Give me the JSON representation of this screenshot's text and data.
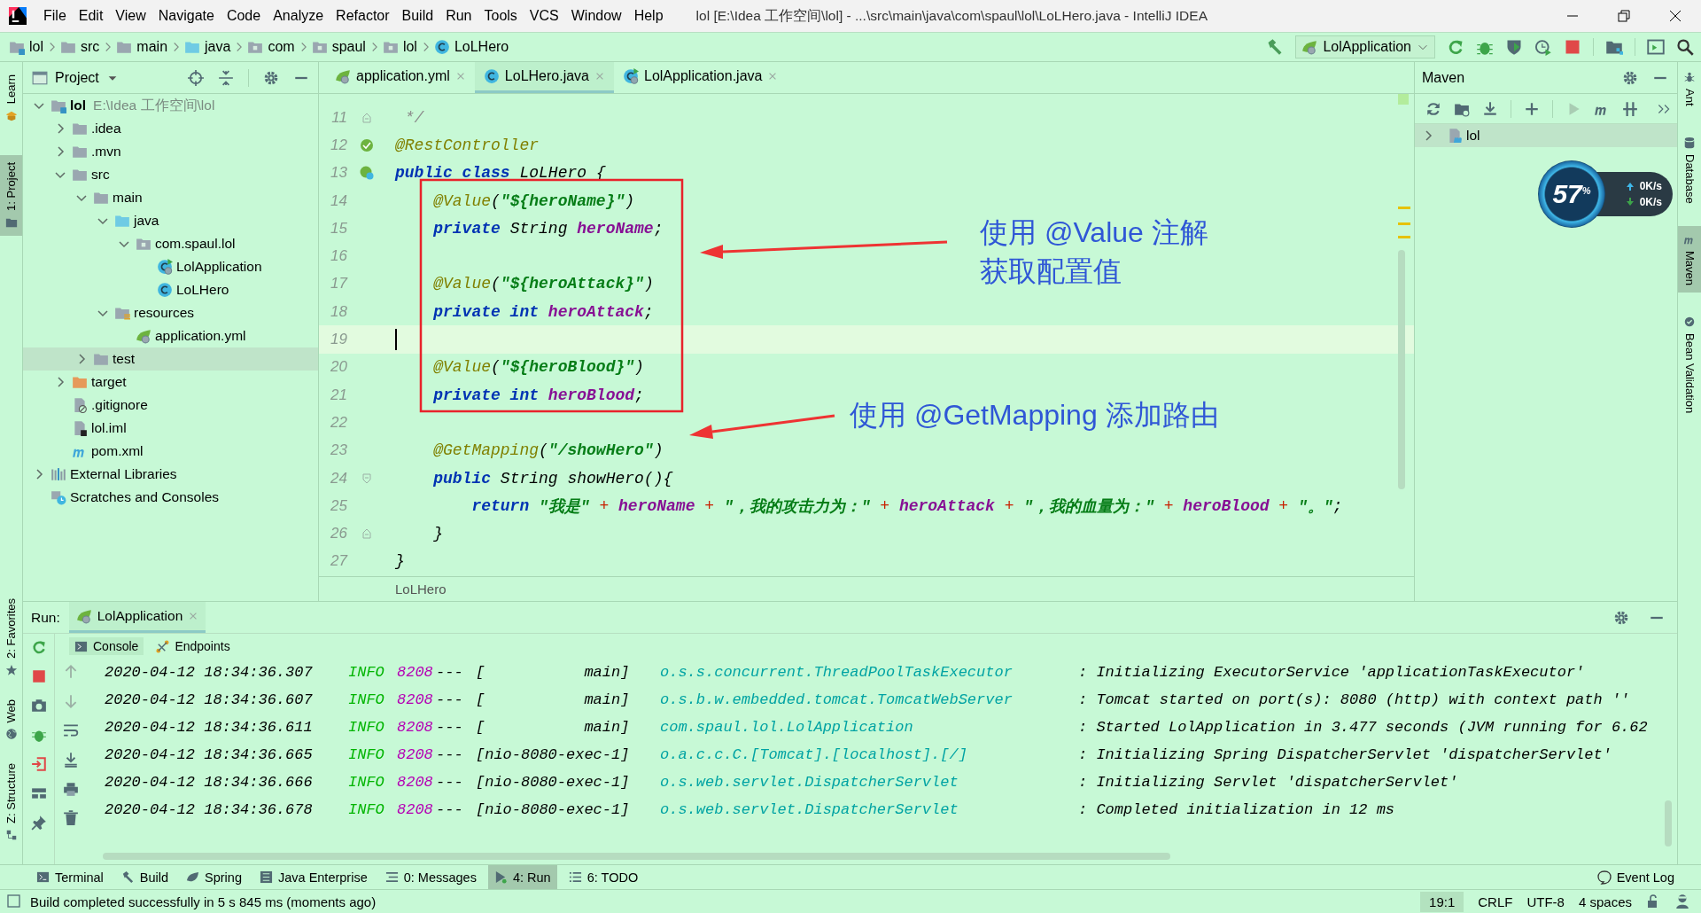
{
  "window": {
    "title": "lol [E:\\Idea 工作空间\\lol] - ...\\src\\main\\java\\com\\spaul\\lol\\LoLHero.java - IntelliJ IDEA"
  },
  "menu": [
    "File",
    "Edit",
    "View",
    "Navigate",
    "Code",
    "Analyze",
    "Refactor",
    "Build",
    "Run",
    "Tools",
    "VCS",
    "Window",
    "Help"
  ],
  "breadcrumbs": [
    {
      "label": "lol",
      "kind": "module"
    },
    {
      "label": "src",
      "kind": "folder"
    },
    {
      "label": "main",
      "kind": "folder"
    },
    {
      "label": "java",
      "kind": "source"
    },
    {
      "label": "com",
      "kind": "package"
    },
    {
      "label": "spaul",
      "kind": "package"
    },
    {
      "label": "lol",
      "kind": "package"
    },
    {
      "label": "LoLHero",
      "kind": "class"
    }
  ],
  "run_config": "LolApplication",
  "left_stripe": [
    {
      "label": "Learn",
      "kind": "learn",
      "selected": false
    },
    {
      "label": "1: Project",
      "kind": "project",
      "selected": true
    }
  ],
  "left_stripe_bottom": [
    {
      "label": "2: Favorites",
      "kind": "star",
      "selected": false
    },
    {
      "label": "Web",
      "kind": "globe",
      "selected": false
    },
    {
      "label": "Z: Structure",
      "kind": "structure",
      "selected": false
    }
  ],
  "right_stripe": [
    {
      "label": "Ant",
      "kind": "ant",
      "selected": false
    },
    {
      "label": "Database",
      "kind": "database",
      "selected": false
    },
    {
      "label": "Maven",
      "kind": "maven",
      "selected": true
    },
    {
      "label": "Bean Validation",
      "kind": "bean",
      "selected": false
    }
  ],
  "project": {
    "title": "Project",
    "tree": [
      {
        "label": "lol",
        "path": "E:\\Idea 工作空间\\lol",
        "kind": "module",
        "expanded": true,
        "selected": false,
        "children": [
          {
            "label": ".idea",
            "kind": "folder",
            "expanded": false,
            "selected": false
          },
          {
            "label": ".mvn",
            "kind": "folder",
            "expanded": false,
            "selected": false
          },
          {
            "label": "src",
            "kind": "folder",
            "expanded": true,
            "selected": false,
            "children": [
              {
                "label": "main",
                "kind": "folder",
                "expanded": true,
                "selected": false,
                "children": [
                  {
                    "label": "java",
                    "kind": "source",
                    "expanded": true,
                    "selected": false,
                    "children": [
                      {
                        "label": "com.spaul.lol",
                        "kind": "package",
                        "expanded": true,
                        "selected": false,
                        "children": [
                          {
                            "label": "LolApplication",
                            "kind": "app",
                            "selected": false
                          },
                          {
                            "label": "LoLHero",
                            "kind": "class",
                            "selected": false
                          }
                        ]
                      }
                    ]
                  },
                  {
                    "label": "resources",
                    "kind": "resources",
                    "expanded": true,
                    "selected": false,
                    "children": [
                      {
                        "label": "application.yml",
                        "kind": "yml",
                        "selected": false
                      }
                    ]
                  }
                ]
              },
              {
                "label": "test",
                "kind": "folder",
                "expanded": false,
                "selected": true
              }
            ]
          },
          {
            "label": "target",
            "kind": "target",
            "expanded": false,
            "selected": false
          },
          {
            "label": ".gitignore",
            "kind": "gitignore",
            "selected": false
          },
          {
            "label": "lol.iml",
            "kind": "iml",
            "selected": false
          },
          {
            "label": "pom.xml",
            "kind": "maven",
            "selected": false
          }
        ]
      },
      {
        "label": "External Libraries",
        "kind": "libraries",
        "expanded": false,
        "selected": false
      },
      {
        "label": "Scratches and Consoles",
        "kind": "scratches",
        "selected": false
      }
    ]
  },
  "editor": {
    "tabs": [
      {
        "label": "application.yml",
        "kind": "yml",
        "selected": false
      },
      {
        "label": "LoLHero.java",
        "kind": "class",
        "selected": true
      },
      {
        "label": "LolApplication.java",
        "kind": "app",
        "selected": false
      }
    ],
    "lines": [
      {
        "number": "11",
        "current": false,
        "gutter_icon": {
          "kind": "fold-end"
        },
        "tokens": [
          {
            "kind": "comment",
            "text": " */"
          }
        ]
      },
      {
        "number": "12",
        "current": false,
        "gutter_icon": {
          "kind": "bean"
        },
        "tokens": [
          {
            "kind": "annotation",
            "text": "@RestController"
          }
        ]
      },
      {
        "number": "13",
        "current": false,
        "gutter_icon": {
          "kind": "bean-class"
        },
        "tokens": [
          {
            "kind": "keyword",
            "text": "public class "
          },
          {
            "kind": "plain",
            "text": "LoLHero {"
          }
        ]
      },
      {
        "number": "14",
        "current": false,
        "tokens": [
          {
            "kind": "annotation",
            "text": "    @Value"
          },
          {
            "kind": "plain",
            "text": "("
          },
          {
            "kind": "string",
            "text": "\"${heroName}\""
          },
          {
            "kind": "plain",
            "text": ")"
          }
        ]
      },
      {
        "number": "15",
        "current": false,
        "tokens": [
          {
            "kind": "keyword",
            "text": "    private "
          },
          {
            "kind": "plain",
            "text": "String "
          },
          {
            "kind": "field",
            "text": "heroName"
          },
          {
            "kind": "plain",
            "text": ";"
          }
        ]
      },
      {
        "number": "16",
        "current": false
      },
      {
        "number": "17",
        "current": false,
        "tokens": [
          {
            "kind": "annotation",
            "text": "    @Value"
          },
          {
            "kind": "plain",
            "text": "("
          },
          {
            "kind": "string",
            "text": "\"${heroAttack}\""
          },
          {
            "kind": "plain",
            "text": ")"
          }
        ]
      },
      {
        "number": "18",
        "current": false,
        "tokens": [
          {
            "kind": "keyword",
            "text": "    private int "
          },
          {
            "kind": "field",
            "text": "heroAttack"
          },
          {
            "kind": "plain",
            "text": ";"
          }
        ]
      },
      {
        "number": "19",
        "current": true
      },
      {
        "number": "20",
        "current": false,
        "tokens": [
          {
            "kind": "annotation",
            "text": "    @Value"
          },
          {
            "kind": "plain",
            "text": "("
          },
          {
            "kind": "string",
            "text": "\"${heroBlood}\""
          },
          {
            "kind": "plain",
            "text": ")"
          }
        ]
      },
      {
        "number": "21",
        "current": false,
        "tokens": [
          {
            "kind": "keyword",
            "text": "    private int "
          },
          {
            "kind": "field",
            "text": "heroBlood"
          },
          {
            "kind": "plain",
            "text": ";"
          }
        ]
      },
      {
        "number": "22",
        "current": false
      },
      {
        "number": "23",
        "current": false,
        "tokens": [
          {
            "kind": "annotation",
            "text": "    @GetMapping"
          },
          {
            "kind": "plain",
            "text": "("
          },
          {
            "kind": "string",
            "text": "\"/showHero\""
          },
          {
            "kind": "plain",
            "text": ")"
          }
        ]
      },
      {
        "number": "24",
        "current": false,
        "gutter_icon": {
          "kind": "fold-start"
        },
        "tokens": [
          {
            "kind": "keyword",
            "text": "    public "
          },
          {
            "kind": "plain",
            "text": "String showHero(){"
          }
        ]
      },
      {
        "number": "25",
        "current": false,
        "tokens": [
          {
            "kind": "keyword",
            "text": "        return "
          },
          {
            "kind": "string",
            "text": "\"我是\""
          },
          {
            "kind": "op",
            "text": " + "
          },
          {
            "kind": "field",
            "text": "heroName"
          },
          {
            "kind": "op",
            "text": " + "
          },
          {
            "kind": "string",
            "text": "\"，我的攻击力为：\""
          },
          {
            "kind": "op",
            "text": " + "
          },
          {
            "kind": "field",
            "text": "heroAttack"
          },
          {
            "kind": "op",
            "text": " + "
          },
          {
            "kind": "string",
            "text": "\"，我的血量为：\""
          },
          {
            "kind": "op",
            "text": " + "
          },
          {
            "kind": "field",
            "text": "heroBlood"
          },
          {
            "kind": "op",
            "text": " + "
          },
          {
            "kind": "string",
            "text": "\"。\""
          },
          {
            "kind": "plain",
            "text": ";"
          }
        ]
      },
      {
        "number": "26",
        "current": false,
        "gutter_icon": {
          "kind": "fold-end"
        },
        "tokens": [
          {
            "kind": "plain",
            "text": "    }"
          }
        ]
      },
      {
        "number": "27",
        "current": false,
        "tokens": [
          {
            "kind": "plain",
            "text": "}"
          }
        ]
      }
    ],
    "annotations": [
      {
        "lines": [
          "使用 @Value 注解",
          "获取配置值"
        ]
      },
      {
        "lines": [
          "使用 @GetMapping 添加路由"
        ]
      }
    ],
    "breadcrumb": "LoLHero"
  },
  "maven": {
    "title": "Maven",
    "tree": [
      {
        "label": "lol",
        "expanded": false,
        "selected": true
      }
    ]
  },
  "net_widget": {
    "percent": "57",
    "unit": "%",
    "up": "0K/s",
    "down": "0K/s"
  },
  "run": {
    "label": "Run:",
    "tab": "LolApplication",
    "subtabs": [
      {
        "label": "Console",
        "kind": "console",
        "selected": true
      },
      {
        "label": "Endpoints",
        "kind": "endpoints",
        "selected": false
      }
    ],
    "log": [
      {
        "time": "2020-04-12 18:34:36.307",
        "level": "INFO",
        "pid": "8208",
        "sep": "---",
        "thread": "[           main]",
        "logger": "o.s.s.concurrent.ThreadPoolTaskExecutor",
        "message": ": Initializing ExecutorService 'applicationTaskExecutor'"
      },
      {
        "time": "2020-04-12 18:34:36.607",
        "level": "INFO",
        "pid": "8208",
        "sep": "---",
        "thread": "[           main]",
        "logger": "o.s.b.w.embedded.tomcat.TomcatWebServer",
        "message": ": Tomcat started on port(s): 8080 (http) with context path ''"
      },
      {
        "time": "2020-04-12 18:34:36.611",
        "level": "INFO",
        "pid": "8208",
        "sep": "---",
        "thread": "[           main]",
        "logger": "com.spaul.lol.LolApplication",
        "message": ": Started LolApplication in 3.477 seconds (JVM running for 6.62"
      },
      {
        "time": "2020-04-12 18:34:36.665",
        "level": "INFO",
        "pid": "8208",
        "sep": "---",
        "thread": "[nio-8080-exec-1]",
        "logger": "o.a.c.c.C.[Tomcat].[localhost].[/]",
        "message": ": Initializing Spring DispatcherServlet 'dispatcherServlet'"
      },
      {
        "time": "2020-04-12 18:34:36.666",
        "level": "INFO",
        "pid": "8208",
        "sep": "---",
        "thread": "[nio-8080-exec-1]",
        "logger": "o.s.web.servlet.DispatcherServlet",
        "message": ": Initializing Servlet 'dispatcherServlet'"
      },
      {
        "time": "2020-04-12 18:34:36.678",
        "level": "INFO",
        "pid": "8208",
        "sep": "---",
        "thread": "[nio-8080-exec-1]",
        "logger": "o.s.web.servlet.DispatcherServlet",
        "message": ": Completed initialization in 12 ms"
      }
    ]
  },
  "tool_windows": [
    {
      "label": "Terminal",
      "kind": "terminal",
      "selected": false
    },
    {
      "label": "Build",
      "kind": "build",
      "selected": false
    },
    {
      "label": "Spring",
      "kind": "spring",
      "selected": false
    },
    {
      "label": "Java Enterprise",
      "kind": "enterprise",
      "selected": false
    },
    {
      "label": "0: Messages",
      "kind": "messages",
      "selected": false
    },
    {
      "label": "4: Run",
      "kind": "run",
      "selected": true
    },
    {
      "label": "6: TODO",
      "kind": "todo",
      "selected": false
    }
  ],
  "event_log": "Event Log",
  "status": {
    "message": "Build completed successfully in 5 s 845 ms (moments ago)",
    "position": "19:1",
    "line_separator": "CRLF",
    "encoding": "UTF-8",
    "indent": "4 spaces"
  }
}
